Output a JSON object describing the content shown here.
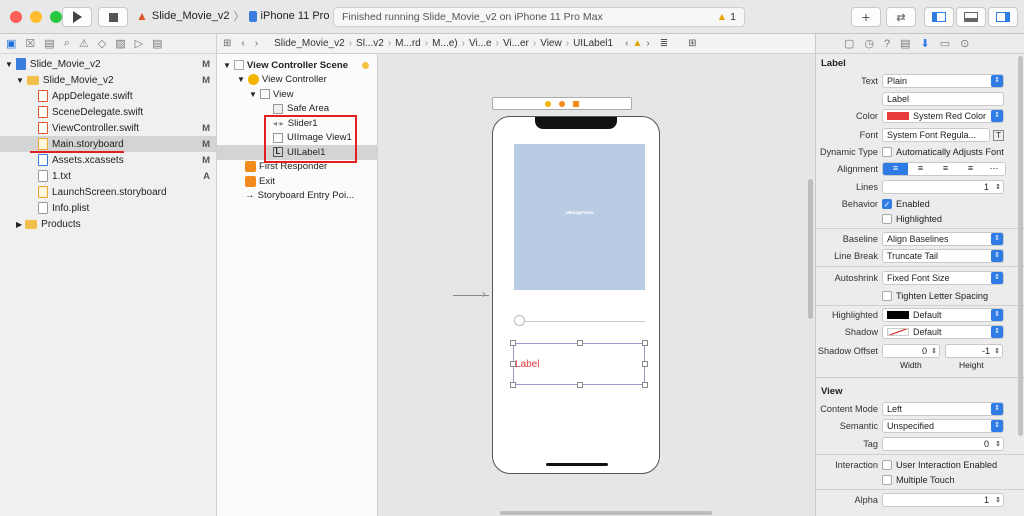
{
  "toolbar": {
    "scheme_project": "Slide_Movie_v2",
    "device": "iPhone 11 Pro Max",
    "status_text": "Finished running Slide_Movie_v2 on iPhone 11 Pro Max",
    "warning_count": "1",
    "colors": {
      "close": "#fe5f57",
      "minimize": "#febc2e",
      "zoom": "#28c840",
      "accent": "#2f7ce6"
    }
  },
  "navigator": {
    "items": [
      {
        "label": "Slide_Movie_v2",
        "status": "M"
      },
      {
        "label": "Slide_Movie_v2",
        "status": "M"
      },
      {
        "label": "AppDelegate.swift",
        "status": ""
      },
      {
        "label": "SceneDelegate.swift",
        "status": ""
      },
      {
        "label": "ViewController.swift",
        "status": "M"
      },
      {
        "label": "Main.storyboard",
        "status": "M"
      },
      {
        "label": "Assets.xcassets",
        "status": "M"
      },
      {
        "label": "1.txt",
        "status": "A"
      },
      {
        "label": "LaunchScreen.storyboard",
        "status": ""
      },
      {
        "label": "Info.plist",
        "status": ""
      },
      {
        "label": "Products",
        "status": ""
      }
    ]
  },
  "jumpbar": {
    "items": [
      "Slide_Movie_v2",
      "Sl...v2",
      "M...rd",
      "M...e)",
      "Vi...e",
      "Vi...er",
      "View",
      "UILabel1"
    ]
  },
  "outline": {
    "items": [
      {
        "label": "View Controller Scene"
      },
      {
        "label": "View Controller"
      },
      {
        "label": "View"
      },
      {
        "label": "Safe Area"
      },
      {
        "label": "Slider1"
      },
      {
        "label": "UIImage View1"
      },
      {
        "label": "UILabel1"
      },
      {
        "label": "First Responder"
      },
      {
        "label": "Exit"
      },
      {
        "label": "Storyboard Entry Poi..."
      }
    ]
  },
  "canvas": {
    "image_view_text": "UIImageView",
    "label_text": "Label"
  },
  "inspector": {
    "label_section": "Label",
    "text_label": "Text",
    "text_value": "Plain",
    "text_content": "Label",
    "color_label": "Color",
    "color_value": "System Red Color",
    "font_label": "Font",
    "font_value": "System Font Regula...",
    "dynamic_type_label": "Dynamic Type",
    "dynamic_type_value": "Automatically Adjusts Font",
    "alignment_label": "Alignment",
    "lines_label": "Lines",
    "lines_value": "1",
    "behavior_label": "Behavior",
    "enabled_label": "Enabled",
    "highlighted_label": "Highlighted",
    "baseline_label": "Baseline",
    "baseline_value": "Align Baselines",
    "line_break_label": "Line Break",
    "line_break_value": "Truncate Tail",
    "autoshrink_label": "Autoshrink",
    "autoshrink_value": "Fixed Font Size",
    "tighten_label": "Tighten Letter Spacing",
    "highlighted_color_label": "Highlighted",
    "highlighted_color_value": "Default",
    "shadow_label": "Shadow",
    "shadow_value": "Default",
    "shadow_offset_label": "Shadow Offset",
    "shadow_w": "0",
    "shadow_h": "-1",
    "width_label": "Width",
    "height_label": "Height",
    "view_section": "View",
    "content_mode_label": "Content Mode",
    "content_mode_value": "Left",
    "semantic_label": "Semantic",
    "semantic_value": "Unspecified",
    "tag_label": "Tag",
    "tag_value": "0",
    "interaction_label": "Interaction",
    "user_interaction_label": "User Interaction Enabled",
    "multiple_touch_label": "Multiple Touch",
    "alpha_label": "Alpha",
    "alpha_value": "1"
  }
}
